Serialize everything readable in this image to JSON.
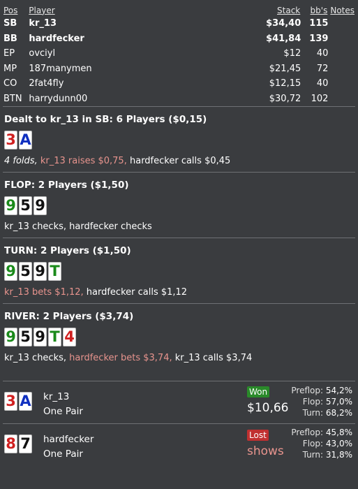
{
  "header": {
    "pos": "Pos",
    "player": "Player",
    "stack": "Stack",
    "bbs": "bb's",
    "notes": "Notes"
  },
  "players": [
    {
      "pos": "SB",
      "name": "kr_13",
      "stack": "$34,40",
      "bbs": "115",
      "bold": true
    },
    {
      "pos": "BB",
      "name": "hardfecker",
      "stack": "$41,84",
      "bbs": "139",
      "bold": true
    },
    {
      "pos": "EP",
      "name": "ovciyl",
      "stack": "$12",
      "bbs": "40",
      "bold": false
    },
    {
      "pos": "MP",
      "name": "187manymen",
      "stack": "$21,45",
      "bbs": "72",
      "bold": false
    },
    {
      "pos": "CO",
      "name": "2fat4fly",
      "stack": "$12,15",
      "bbs": "40",
      "bold": false
    },
    {
      "pos": "BTN",
      "name": "harrydunn00",
      "stack": "$30,72",
      "bbs": "102",
      "bold": false
    }
  ],
  "preflop": {
    "title": "Dealt to kr_13 in SB: 6 Players ($0,15)",
    "cards": [
      {
        "rank": "3",
        "color": "#d02020"
      },
      {
        "rank": "A",
        "color": "#1030c0"
      }
    ],
    "actions": [
      {
        "text": "4 folds, ",
        "style": "it"
      },
      {
        "text": "kr_13 raises $0,75, ",
        "style": "hl"
      },
      {
        "text": "hardfecker calls $0,45",
        "style": ""
      }
    ]
  },
  "flop": {
    "title": "FLOP: 2 Players ($1,50)",
    "cards": [
      {
        "rank": "9",
        "color": "#1a8a1a"
      },
      {
        "rank": "5",
        "color": "#111111"
      },
      {
        "rank": "9",
        "color": "#111111"
      }
    ],
    "actions": [
      {
        "text": "kr_13 checks, hardfecker checks",
        "style": ""
      }
    ]
  },
  "turn": {
    "title": "TURN: 2 Players ($1,50)",
    "cards": [
      {
        "rank": "9",
        "color": "#1a8a1a"
      },
      {
        "rank": "5",
        "color": "#111111"
      },
      {
        "rank": "9",
        "color": "#111111"
      },
      {
        "rank": "T",
        "color": "#1a8a1a"
      }
    ],
    "actions": [
      {
        "text": "kr_13 bets $1,12, ",
        "style": "hl"
      },
      {
        "text": "hardfecker calls $1,12",
        "style": ""
      }
    ]
  },
  "river": {
    "title": "RIVER: 2 Players ($3,74)",
    "cards": [
      {
        "rank": "9",
        "color": "#1a8a1a"
      },
      {
        "rank": "5",
        "color": "#111111"
      },
      {
        "rank": "9",
        "color": "#111111"
      },
      {
        "rank": "T",
        "color": "#1a8a1a"
      },
      {
        "rank": "4",
        "color": "#d02020"
      }
    ],
    "actions": [
      {
        "text": "kr_13 checks, ",
        "style": ""
      },
      {
        "text": "hardfecker bets $3,74, ",
        "style": "hl"
      },
      {
        "text": "kr_13 calls $3,74",
        "style": ""
      }
    ]
  },
  "results": [
    {
      "cards": [
        {
          "rank": "3",
          "color": "#d02020"
        },
        {
          "rank": "A",
          "color": "#1030c0"
        }
      ],
      "name": "kr_13",
      "hand": "One Pair",
      "badge": "Won",
      "badge_color": "#2a8a2a",
      "amount": "$10,66",
      "amount_color": "#ffffff",
      "equity": [
        {
          "label": "Preflop:",
          "value": "54,2%"
        },
        {
          "label": "Flop:",
          "value": "57,0%"
        },
        {
          "label": "Turn:",
          "value": "68,2%"
        }
      ]
    },
    {
      "cards": [
        {
          "rank": "8",
          "color": "#d02020"
        },
        {
          "rank": "7",
          "color": "#111111"
        }
      ],
      "name": "hardfecker",
      "hand": "One Pair",
      "badge": "Lost",
      "badge_color": "#c03030",
      "amount": "shows",
      "amount_color": "#e8948e",
      "equity": [
        {
          "label": "Preflop:",
          "value": "45,8%"
        },
        {
          "label": "Flop:",
          "value": "43,0%"
        },
        {
          "label": "Turn:",
          "value": "31,8%"
        }
      ]
    }
  ]
}
